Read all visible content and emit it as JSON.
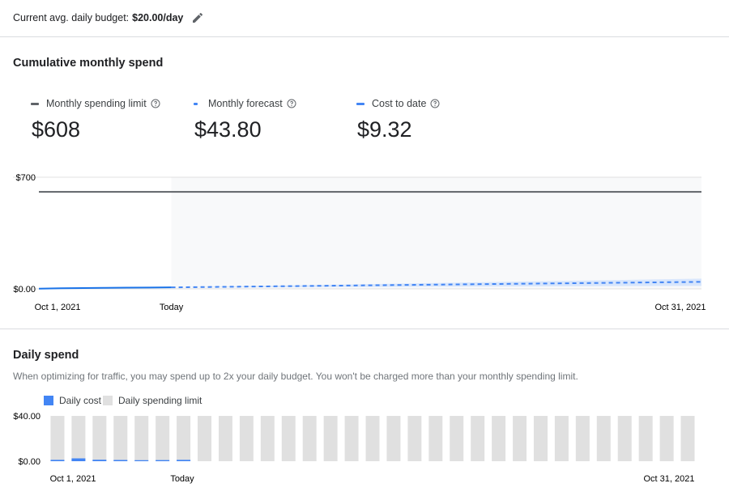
{
  "header": {
    "budget_label": "Current avg. daily budget:",
    "budget_value": "$20.00/day"
  },
  "cumulative": {
    "title": "Cumulative monthly spend",
    "metrics": [
      {
        "label": "Monthly spending limit",
        "value": "$608",
        "color": "#5f6368"
      },
      {
        "label": "Monthly forecast",
        "value": "$43.80",
        "color": "#4285f4"
      },
      {
        "label": "Cost to date",
        "value": "$9.32",
        "color": "#4285f4"
      }
    ],
    "chart_data": {
      "type": "line",
      "title": "Cumulative monthly spend",
      "ytick_labels": [
        "$700",
        "$0.00"
      ],
      "xtick_labels": [
        "Oct 1, 2021",
        "Today",
        "Oct 31, 2021"
      ],
      "ylim": [
        0,
        700
      ],
      "x_days": [
        1,
        31
      ],
      "today_day": 7,
      "series": [
        {
          "name": "Monthly spending limit",
          "x": [
            1,
            31
          ],
          "y": [
            608,
            608
          ],
          "style": "solid",
          "color": "#5f6368"
        },
        {
          "name": "Cost to date",
          "x": [
            1,
            2,
            3,
            4,
            5,
            6,
            7
          ],
          "y": [
            1.2,
            3.5,
            5.0,
            6.3,
            7.4,
            8.4,
            9.32
          ],
          "style": "solid",
          "color": "#1a73e8"
        },
        {
          "name": "Monthly forecast",
          "x": [
            7,
            31
          ],
          "y": [
            9.32,
            43.8
          ],
          "style": "dashed",
          "color": "#4285f4"
        }
      ],
      "grid": true
    }
  },
  "daily": {
    "title": "Daily spend",
    "description": "When optimizing for traffic, you may spend up to 2x your daily budget. You won't be charged more than your monthly spending limit.",
    "legend": [
      {
        "label": "Daily cost",
        "color": "#4285f4"
      },
      {
        "label": "Daily spending limit",
        "color": "#e0e0e0"
      }
    ],
    "chart_data": {
      "type": "bar",
      "ytick_labels": [
        "$40.00",
        "$0.00"
      ],
      "xtick_labels": [
        "Oct 1, 2021",
        "Today",
        "Oct 31, 2021"
      ],
      "ylim": [
        0,
        40
      ],
      "days": 31,
      "today_day": 7,
      "series": [
        {
          "name": "Daily spending limit",
          "values": [
            40,
            40,
            40,
            40,
            40,
            40,
            40,
            40,
            40,
            40,
            40,
            40,
            40,
            40,
            40,
            40,
            40,
            40,
            40,
            40,
            40,
            40,
            40,
            40,
            40,
            40,
            40,
            40,
            40,
            40,
            40
          ],
          "color": "#e0e0e0"
        },
        {
          "name": "Daily cost",
          "values": [
            1.2,
            2.5,
            1.3,
            1.1,
            0.9,
            1.0,
            1.2
          ],
          "color": "#4285f4"
        }
      ]
    }
  }
}
